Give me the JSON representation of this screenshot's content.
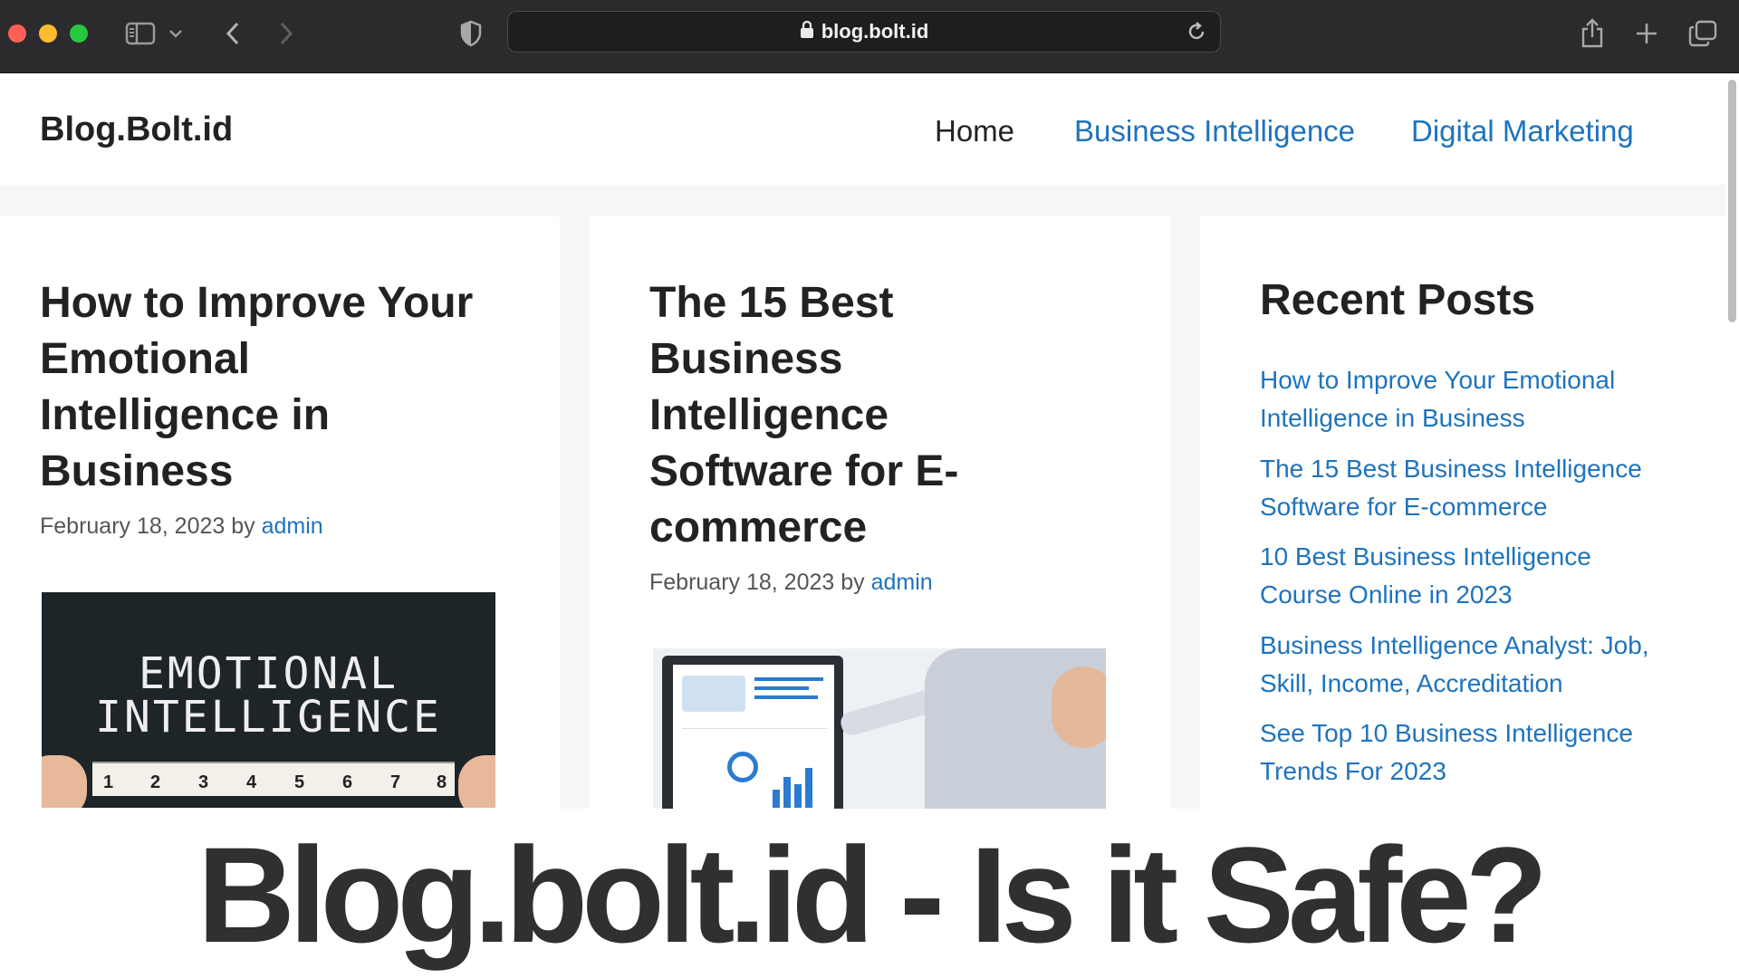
{
  "browser": {
    "url": "blog.bolt.id",
    "icons": [
      "close-dot",
      "minimize-dot",
      "zoom-dot",
      "sidebar-icon",
      "chevron-down-icon",
      "back-icon",
      "forward-icon",
      "shield-icon",
      "lock-icon",
      "reload-icon",
      "share-icon",
      "new-tab-icon",
      "tabs-overview-icon"
    ]
  },
  "site": {
    "title": "Blog.Bolt.id",
    "nav": {
      "home": "Home",
      "business_intelligence": "Business Intelligence",
      "digital_marketing": "Digital Marketing"
    }
  },
  "posts": [
    {
      "title_lines": [
        "How to Improve Your",
        "Emotional",
        "Intelligence in",
        "Business"
      ],
      "date": "February 18, 2023",
      "by": "by",
      "author": "admin",
      "image": {
        "caption_lines": [
          "EMOTIONAL",
          "INTELLIGENCE"
        ],
        "ruler_numbers": [
          "1",
          "2",
          "3",
          "4",
          "5",
          "6",
          "7",
          "8"
        ]
      }
    },
    {
      "title_lines": [
        "The 15 Best",
        "Business",
        "Intelligence",
        "Software for E-",
        "commerce"
      ],
      "date": "February 18, 2023",
      "by": "by",
      "author": "admin"
    }
  ],
  "sidebar": {
    "widget_title": "Recent Posts",
    "recent_posts": [
      [
        "How to Improve Your Emotional",
        "Intelligence in Business"
      ],
      [
        "The 15 Best Business Intelligence",
        "Software for E-commerce"
      ],
      [
        "10 Best Business Intelligence",
        "Course Online in 2023"
      ],
      [
        "Business Intelligence Analyst: Job,",
        "Skill, Income, Accreditation"
      ],
      [
        "See Top 10 Business Intelligence",
        "Trends For 2023"
      ]
    ]
  },
  "banner": {
    "text": "Blog.bolt.id - Is it Safe?"
  },
  "colors": {
    "link": "#1e73be",
    "text": "#222222",
    "chrome": "#2b2b2d",
    "banner_text": "#303030"
  }
}
